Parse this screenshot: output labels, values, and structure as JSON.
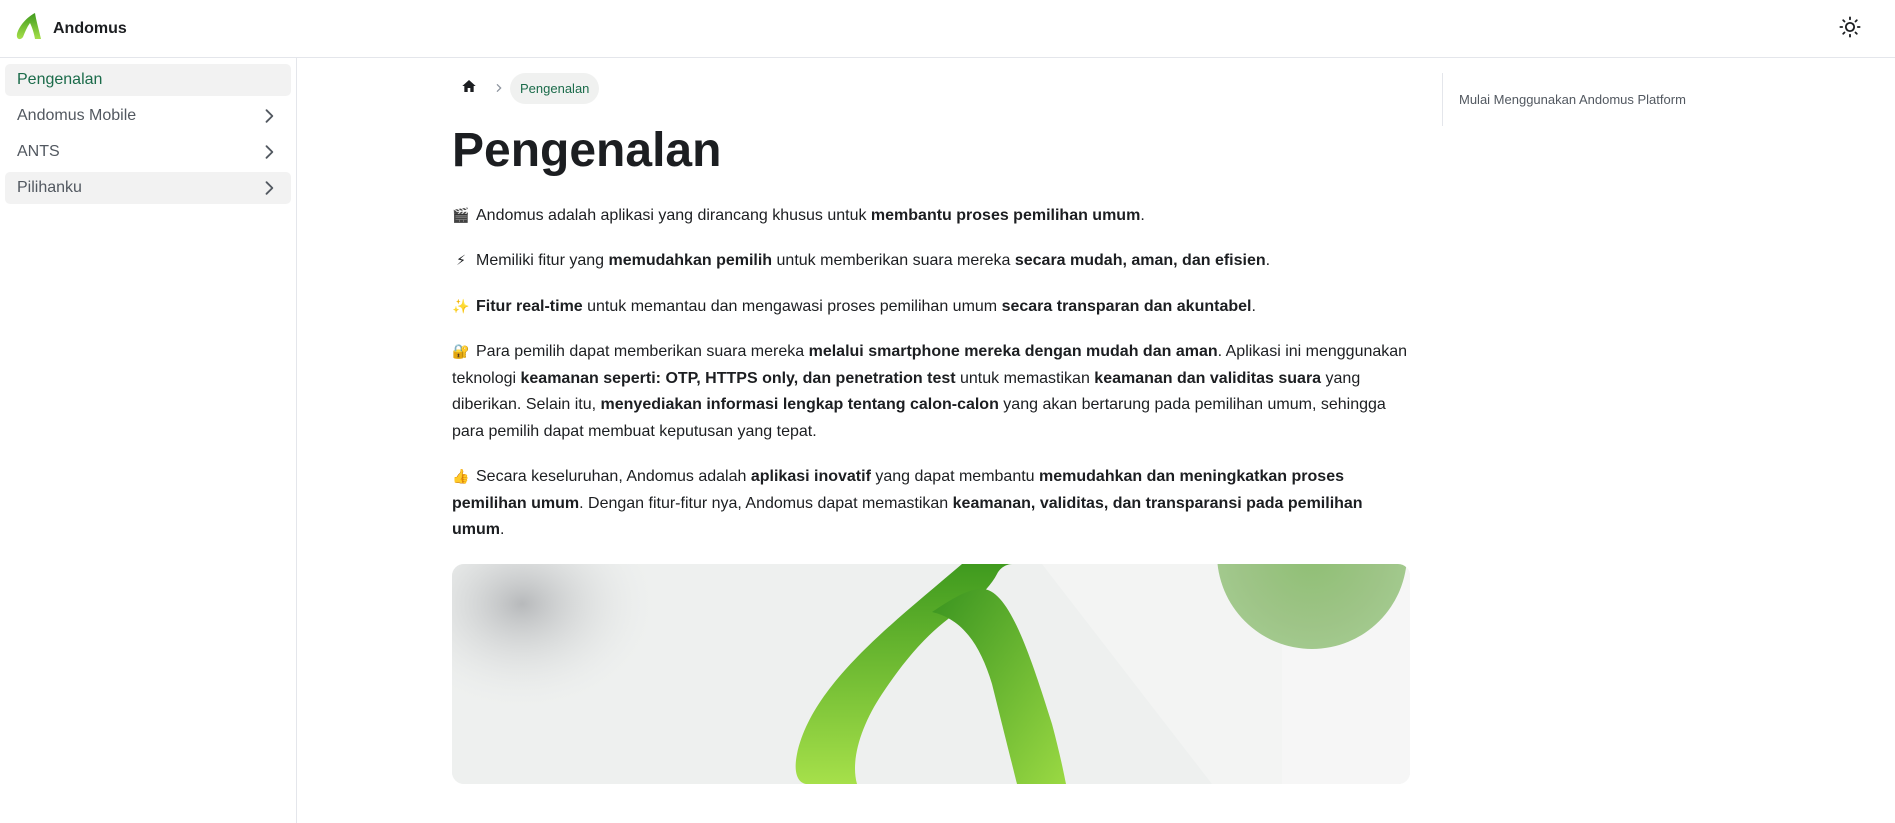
{
  "navbar": {
    "brand_title": "Andomus",
    "logo_icon": "andomus-logo",
    "theme_toggle_icon": "sun-icon"
  },
  "sidebar": {
    "items": [
      {
        "label": "Pengenalan",
        "active": true,
        "has_children": false
      },
      {
        "label": "Andomus Mobile",
        "active": false,
        "has_children": true
      },
      {
        "label": "ANTS",
        "active": false,
        "has_children": true
      },
      {
        "label": "Pilihanku",
        "active": false,
        "has_children": true
      }
    ]
  },
  "breadcrumb": {
    "home_icon": "home-icon",
    "current": "Pengenalan"
  },
  "main": {
    "title": "Pengenalan",
    "paragraphs": [
      {
        "emoji": "🎬",
        "segments": [
          {
            "text": "Andomus adalah aplikasi yang dirancang khusus untuk ",
            "bold": false
          },
          {
            "text": "membantu proses pemilihan umum",
            "bold": true
          },
          {
            "text": ".",
            "bold": false
          }
        ]
      },
      {
        "emoji": "⚡",
        "segments": [
          {
            "text": "Memiliki fitur yang ",
            "bold": false
          },
          {
            "text": "memudahkan pemilih",
            "bold": true
          },
          {
            "text": " untuk memberikan suara mereka ",
            "bold": false
          },
          {
            "text": "secara mudah, aman, dan efisien",
            "bold": true
          },
          {
            "text": ".",
            "bold": false
          }
        ]
      },
      {
        "emoji": "✨",
        "segments": [
          {
            "text": "Fitur real-time",
            "bold": true
          },
          {
            "text": " untuk memantau dan mengawasi proses pemilihan umum ",
            "bold": false
          },
          {
            "text": "secara transparan dan akuntabel",
            "bold": true
          },
          {
            "text": ".",
            "bold": false
          }
        ]
      },
      {
        "emoji": "🔐",
        "segments": [
          {
            "text": "Para pemilih dapat memberikan suara mereka ",
            "bold": false
          },
          {
            "text": "melalui smartphone mereka dengan mudah dan aman",
            "bold": true
          },
          {
            "text": ". Aplikasi ini menggunakan teknologi ",
            "bold": false
          },
          {
            "text": "keamanan seperti: OTP, HTTPS only, dan penetration test",
            "bold": true
          },
          {
            "text": " untuk memastikan ",
            "bold": false
          },
          {
            "text": "keamanan dan validitas suara",
            "bold": true
          },
          {
            "text": " yang diberikan. Selain itu, ",
            "bold": false
          },
          {
            "text": "menyediakan informasi lengkap tentang calon-calon",
            "bold": true
          },
          {
            "text": " yang akan bertarung pada pemilihan umum, sehingga para pemilih dapat membuat keputusan yang tepat.",
            "bold": false
          }
        ]
      },
      {
        "emoji": "👍",
        "segments": [
          {
            "text": "Secara keseluruhan, Andomus adalah ",
            "bold": false
          },
          {
            "text": "aplikasi inovatif",
            "bold": true
          },
          {
            "text": " yang dapat membantu ",
            "bold": false
          },
          {
            "text": "memudahkan dan meningkatkan proses pemilihan umum",
            "bold": true
          },
          {
            "text": ". Dengan fitur-fitur nya, Andomus dapat memastikan ",
            "bold": false
          },
          {
            "text": "keamanan, validitas, dan transparansi pada pemilihan umum",
            "bold": true
          },
          {
            "text": ".",
            "bold": false
          }
        ]
      }
    ]
  },
  "toc": {
    "items": [
      "Mulai Menggunakan Andomus Platform"
    ]
  },
  "colors": {
    "accent": "#1b6b4a",
    "brand_green": "#5cb82e",
    "border": "#e4e6eb"
  }
}
